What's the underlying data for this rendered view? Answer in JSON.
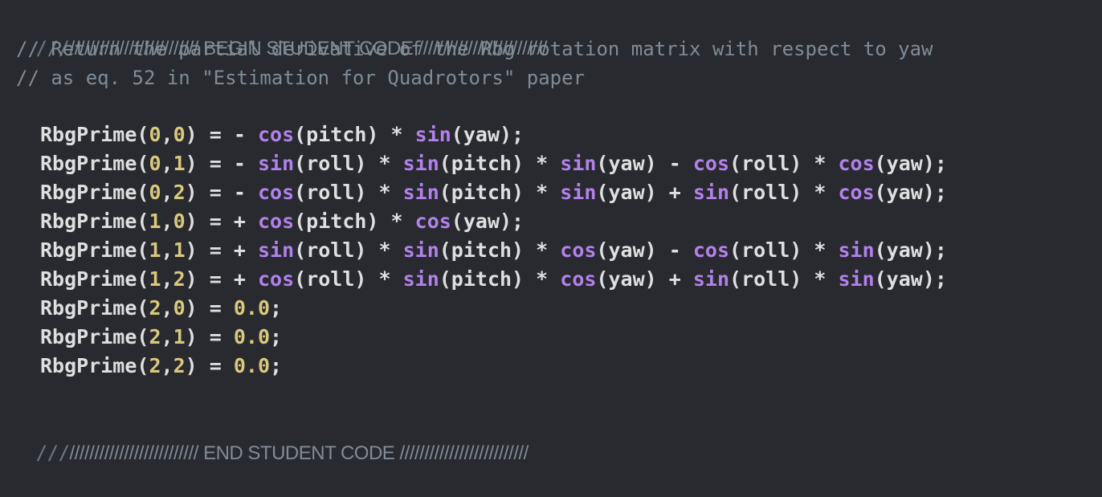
{
  "editor": {
    "begin_marker": {
      "slashes": "///",
      "text": "////////////////////////// BEGIN STUDENT CODE //////////////////////////"
    },
    "comment_lines": [
      "// Return the partial derivative of the Rbg rotation matrix with respect to yaw",
      "// as eq. 52 in \"Estimation for Quadrotors\" paper"
    ],
    "code_lines": [
      [
        {
          "t": "RbgPrime(",
          "c": "plain"
        },
        {
          "t": "0",
          "c": "num"
        },
        {
          "t": ",",
          "c": "plain"
        },
        {
          "t": "0",
          "c": "num"
        },
        {
          "t": ") = - ",
          "c": "plain"
        },
        {
          "t": "cos",
          "c": "fn"
        },
        {
          "t": "(pitch) * ",
          "c": "plain"
        },
        {
          "t": "sin",
          "c": "fn"
        },
        {
          "t": "(yaw);",
          "c": "plain"
        }
      ],
      [
        {
          "t": "RbgPrime(",
          "c": "plain"
        },
        {
          "t": "0",
          "c": "num"
        },
        {
          "t": ",",
          "c": "plain"
        },
        {
          "t": "1",
          "c": "num"
        },
        {
          "t": ") = - ",
          "c": "plain"
        },
        {
          "t": "sin",
          "c": "fn"
        },
        {
          "t": "(roll) * ",
          "c": "plain"
        },
        {
          "t": "sin",
          "c": "fn"
        },
        {
          "t": "(pitch) * ",
          "c": "plain"
        },
        {
          "t": "sin",
          "c": "fn"
        },
        {
          "t": "(yaw) - ",
          "c": "plain"
        },
        {
          "t": "cos",
          "c": "fn"
        },
        {
          "t": "(roll) * ",
          "c": "plain"
        },
        {
          "t": "cos",
          "c": "fn"
        },
        {
          "t": "(yaw);",
          "c": "plain"
        }
      ],
      [
        {
          "t": "RbgPrime(",
          "c": "plain"
        },
        {
          "t": "0",
          "c": "num"
        },
        {
          "t": ",",
          "c": "plain"
        },
        {
          "t": "2",
          "c": "num"
        },
        {
          "t": ") = - ",
          "c": "plain"
        },
        {
          "t": "cos",
          "c": "fn"
        },
        {
          "t": "(roll) * ",
          "c": "plain"
        },
        {
          "t": "sin",
          "c": "fn"
        },
        {
          "t": "(pitch) * ",
          "c": "plain"
        },
        {
          "t": "sin",
          "c": "fn"
        },
        {
          "t": "(yaw) + ",
          "c": "plain"
        },
        {
          "t": "sin",
          "c": "fn"
        },
        {
          "t": "(roll) * ",
          "c": "plain"
        },
        {
          "t": "cos",
          "c": "fn"
        },
        {
          "t": "(yaw);",
          "c": "plain"
        }
      ],
      [
        {
          "t": "RbgPrime(",
          "c": "plain"
        },
        {
          "t": "1",
          "c": "num"
        },
        {
          "t": ",",
          "c": "plain"
        },
        {
          "t": "0",
          "c": "num"
        },
        {
          "t": ") = + ",
          "c": "plain"
        },
        {
          "t": "cos",
          "c": "fn"
        },
        {
          "t": "(pitch) * ",
          "c": "plain"
        },
        {
          "t": "cos",
          "c": "fn"
        },
        {
          "t": "(yaw);",
          "c": "plain"
        }
      ],
      [
        {
          "t": "RbgPrime(",
          "c": "plain"
        },
        {
          "t": "1",
          "c": "num"
        },
        {
          "t": ",",
          "c": "plain"
        },
        {
          "t": "1",
          "c": "num"
        },
        {
          "t": ") = + ",
          "c": "plain"
        },
        {
          "t": "sin",
          "c": "fn"
        },
        {
          "t": "(roll) * ",
          "c": "plain"
        },
        {
          "t": "sin",
          "c": "fn"
        },
        {
          "t": "(pitch) * ",
          "c": "plain"
        },
        {
          "t": "cos",
          "c": "fn"
        },
        {
          "t": "(yaw) - ",
          "c": "plain"
        },
        {
          "t": "cos",
          "c": "fn"
        },
        {
          "t": "(roll) * ",
          "c": "plain"
        },
        {
          "t": "sin",
          "c": "fn"
        },
        {
          "t": "(yaw);",
          "c": "plain"
        }
      ],
      [
        {
          "t": "RbgPrime(",
          "c": "plain"
        },
        {
          "t": "1",
          "c": "num"
        },
        {
          "t": ",",
          "c": "plain"
        },
        {
          "t": "2",
          "c": "num"
        },
        {
          "t": ") = + ",
          "c": "plain"
        },
        {
          "t": "cos",
          "c": "fn"
        },
        {
          "t": "(roll) * ",
          "c": "plain"
        },
        {
          "t": "sin",
          "c": "fn"
        },
        {
          "t": "(pitch) * ",
          "c": "plain"
        },
        {
          "t": "cos",
          "c": "fn"
        },
        {
          "t": "(yaw) + ",
          "c": "plain"
        },
        {
          "t": "sin",
          "c": "fn"
        },
        {
          "t": "(roll) * ",
          "c": "plain"
        },
        {
          "t": "sin",
          "c": "fn"
        },
        {
          "t": "(yaw);",
          "c": "plain"
        }
      ],
      [
        {
          "t": "RbgPrime(",
          "c": "plain"
        },
        {
          "t": "2",
          "c": "num"
        },
        {
          "t": ",",
          "c": "plain"
        },
        {
          "t": "0",
          "c": "num"
        },
        {
          "t": ") = ",
          "c": "plain"
        },
        {
          "t": "0.0",
          "c": "num"
        },
        {
          "t": ";",
          "c": "plain"
        }
      ],
      [
        {
          "t": "RbgPrime(",
          "c": "plain"
        },
        {
          "t": "2",
          "c": "num"
        },
        {
          "t": ",",
          "c": "plain"
        },
        {
          "t": "1",
          "c": "num"
        },
        {
          "t": ") = ",
          "c": "plain"
        },
        {
          "t": "0.0",
          "c": "num"
        },
        {
          "t": ";",
          "c": "plain"
        }
      ],
      [
        {
          "t": "RbgPrime(",
          "c": "plain"
        },
        {
          "t": "2",
          "c": "num"
        },
        {
          "t": ",",
          "c": "plain"
        },
        {
          "t": "2",
          "c": "num"
        },
        {
          "t": ") = ",
          "c": "plain"
        },
        {
          "t": "0.0",
          "c": "num"
        },
        {
          "t": ";",
          "c": "plain"
        }
      ]
    ],
    "end_marker": {
      "slashes": "///",
      "text": "////////////////////////// END STUDENT CODE //////////////////////////"
    }
  },
  "colors": {
    "background": "#292a30",
    "comment": "#7f8c98",
    "plain": "#dfdfe0",
    "function": "#b281eb",
    "number": "#d9c97c"
  }
}
